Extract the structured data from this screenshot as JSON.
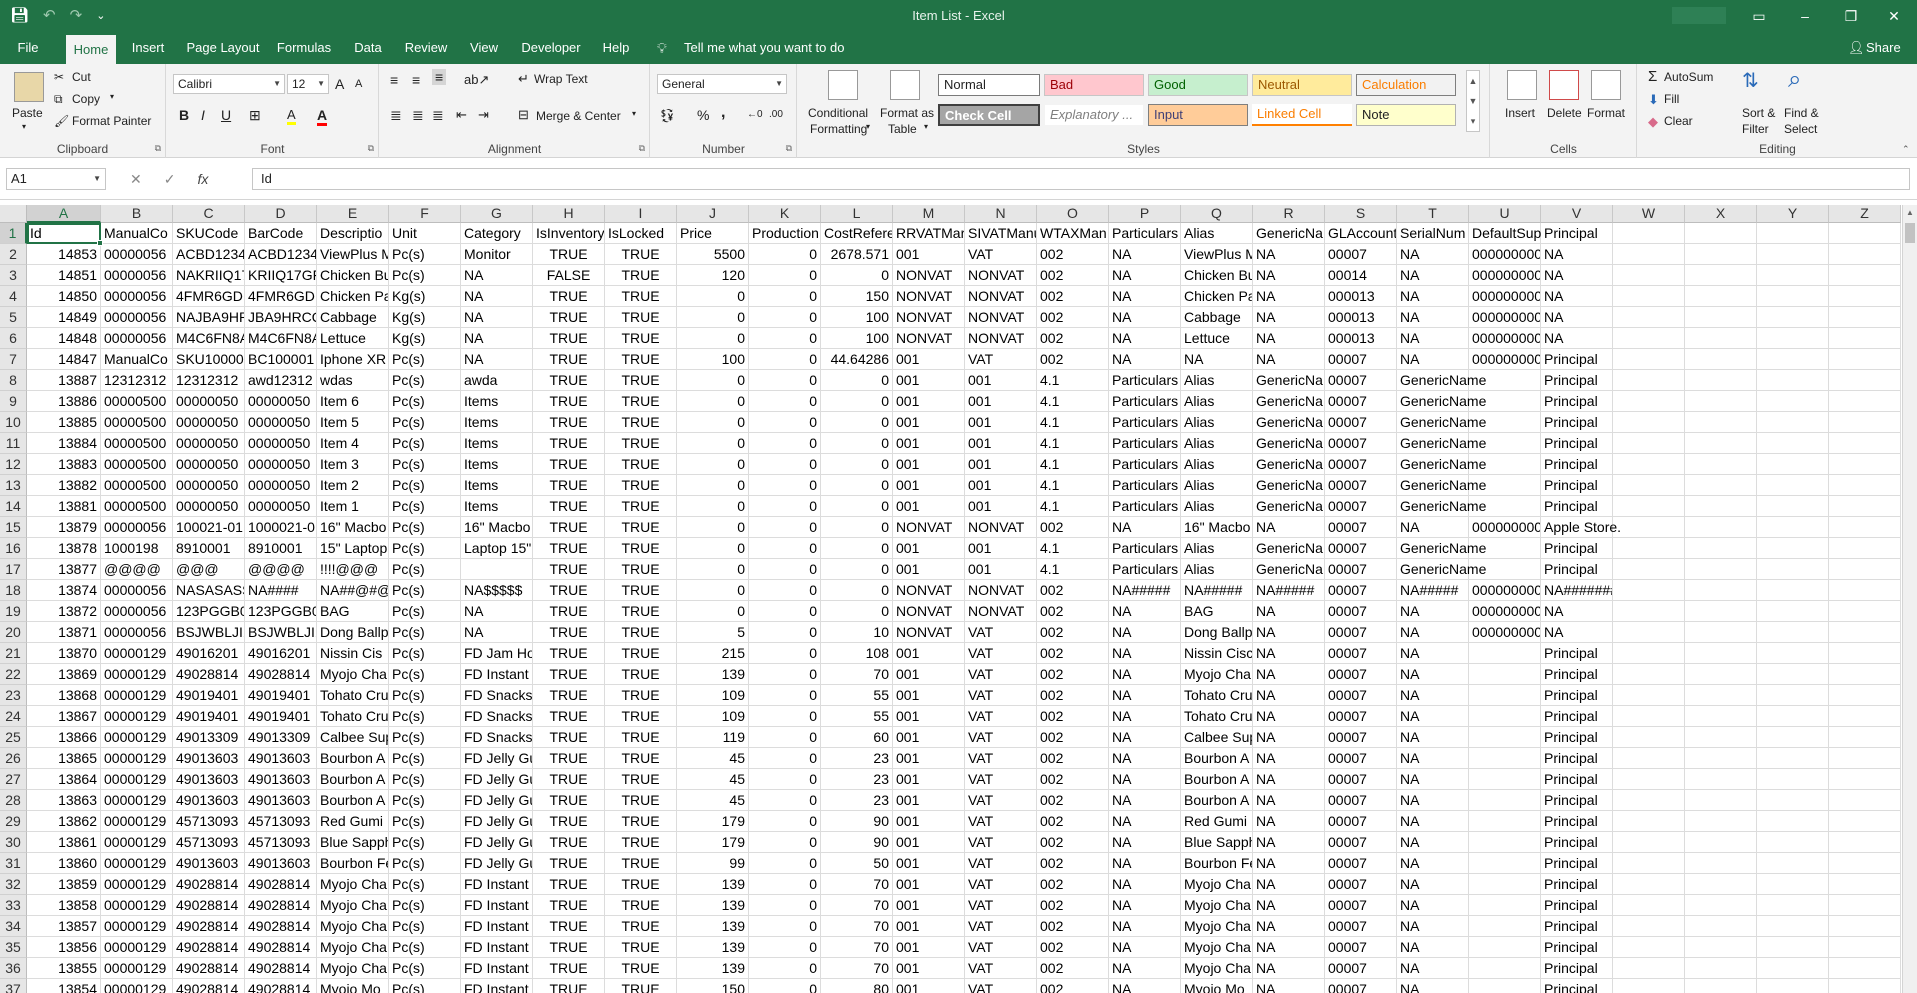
{
  "titlebar": {
    "title": "Item List  -  Excel",
    "save_icon": "save-icon",
    "undo_icon": "undo-icon",
    "redo_icon": "redo-icon",
    "customize_icon": "customize-qat-icon",
    "ribbon_display_icon": "ribbon-display-icon",
    "minimize": "–",
    "restore": "❐",
    "close": "✕"
  },
  "tabs": [
    "File",
    "Home",
    "Insert",
    "Page Layout",
    "Formulas",
    "Data",
    "Review",
    "View",
    "Developer",
    "Help"
  ],
  "active_tab": "Home",
  "tell_me": "Tell me what you want to do",
  "share": "Share",
  "ribbon": {
    "clipboard": {
      "name": "Clipboard",
      "paste": "Paste",
      "cut": "Cut",
      "copy": "Copy",
      "format_painter": "Format Painter"
    },
    "font": {
      "name": "Font",
      "family": "Calibri",
      "size": "12",
      "bold": "B",
      "italic": "I",
      "underline": "U",
      "grow": "A",
      "shrink": "A",
      "fill": "A",
      "color": "A"
    },
    "alignment": {
      "name": "Alignment",
      "wrap": "Wrap Text",
      "merge": "Merge & Center"
    },
    "number": {
      "name": "Number",
      "format": "General",
      "percent": "%",
      "comma": ","
    },
    "styles": {
      "name": "Styles",
      "conditional": "Conditional",
      "conditional2": "Formatting",
      "format_table": "Format as",
      "format_table2": "Table",
      "normal": "Normal",
      "bad": "Bad",
      "good": "Good",
      "neutral": "Neutral",
      "calculation": "Calculation",
      "check_cell": "Check Cell",
      "explanatory": "Explanatory ...",
      "input": "Input",
      "linked_cell": "Linked Cell",
      "note": "Note"
    },
    "cells": {
      "name": "Cells",
      "insert": "Insert",
      "delete": "Delete",
      "format": "Format"
    },
    "editing": {
      "name": "Editing",
      "autosum": "AutoSum",
      "fill": "Fill",
      "clear": "Clear",
      "sort": "Sort &",
      "sort2": "Filter",
      "find": "Find &",
      "find2": "Select"
    }
  },
  "formula_bar": {
    "name_box": "A1",
    "cancel": "✕",
    "enter": "✓",
    "fx": "fx",
    "content": "Id"
  },
  "columns": [
    "A",
    "B",
    "C",
    "D",
    "E",
    "F",
    "G",
    "H",
    "I",
    "J",
    "K",
    "L",
    "M",
    "N",
    "O",
    "P",
    "Q",
    "R",
    "S",
    "T",
    "U",
    "V",
    "W",
    "X",
    "Y",
    "Z"
  ],
  "row_numbers": [
    "1",
    "2",
    "3",
    "4",
    "5",
    "6",
    "7",
    "8",
    "9",
    "10",
    "11",
    "12",
    "13",
    "14",
    "15",
    "16",
    "17",
    "18",
    "19",
    "20",
    "21",
    "22",
    "23",
    "24",
    "25",
    "26",
    "27",
    "28",
    "29",
    "30",
    "31",
    "32",
    "33",
    "34",
    "35",
    "36",
    "37"
  ],
  "rows": [
    [
      "Id",
      "ManualCo",
      "SKUCode",
      "BarCode",
      "Descriptio",
      "Unit",
      "Category",
      "IsInventory",
      "IsLocked",
      "Price",
      "Production",
      "CostRefere",
      "RRVATMar",
      "SIVATManu",
      "WTAXMan",
      "Particulars",
      "Alias",
      "GenericNa",
      "GLAccount",
      "SerialNum",
      "DefaultSup",
      "Principal"
    ],
    [
      "14853",
      "00000056",
      "ACBD1234",
      "ACBD1234",
      "ViewPlus M",
      "Pc(s)",
      "Monitor",
      "TRUE",
      "TRUE",
      "5500",
      "0",
      "2678.571",
      "001",
      "VAT",
      "002",
      "NA",
      "ViewPlus M",
      "NA",
      "00007",
      "NA",
      "000000000",
      "NA"
    ],
    [
      "14851",
      "00000056",
      "NAKRIIQ17",
      "KRIIQ17GF",
      "Chicken Bu",
      "Pc(s)",
      "NA",
      "FALSE",
      "TRUE",
      "120",
      "0",
      "0",
      "NONVAT",
      "NONVAT",
      "002",
      "NA",
      "Chicken Bu",
      "NA",
      "00014",
      "NA",
      "000000000",
      "NA"
    ],
    [
      "14850",
      "00000056",
      "4FMR6GDI",
      "4FMR6GDI",
      "Chicken Pa",
      "Kg(s)",
      "NA",
      "TRUE",
      "TRUE",
      "0",
      "0",
      "150",
      "NONVAT",
      "NONVAT",
      "002",
      "NA",
      "Chicken Pa",
      "NA",
      "000013",
      "NA",
      "000000000",
      "NA"
    ],
    [
      "14849",
      "00000056",
      "NAJBA9HR",
      "JBA9HRCQ",
      "Cabbage",
      "Kg(s)",
      "NA",
      "TRUE",
      "TRUE",
      "0",
      "0",
      "100",
      "NONVAT",
      "NONVAT",
      "002",
      "NA",
      "Cabbage",
      "NA",
      "000013",
      "NA",
      "000000000",
      "NA"
    ],
    [
      "14848",
      "00000056",
      "M4C6FN8A",
      "M4C6FN8A",
      "Lettuce",
      "Kg(s)",
      "NA",
      "TRUE",
      "TRUE",
      "0",
      "0",
      "100",
      "NONVAT",
      "NONVAT",
      "002",
      "NA",
      "Lettuce",
      "NA",
      "000013",
      "NA",
      "000000000",
      "NA"
    ],
    [
      "14847",
      "ManualCo",
      "SKU10000",
      "BC100001",
      "Iphone XR",
      "Pc(s)",
      "NA",
      "TRUE",
      "TRUE",
      "100",
      "0",
      "44.64286",
      "001",
      "VAT",
      "002",
      "NA",
      "NA",
      "NA",
      "00007",
      "NA",
      "000000000",
      "Principal"
    ],
    [
      "13887",
      "12312312",
      "12312312",
      "awd12312",
      "wdas",
      "Pc(s)",
      "awda",
      "TRUE",
      "TRUE",
      "0",
      "0",
      "0",
      "001",
      "001",
      "4.1",
      "Particulars",
      "Alias",
      "GenericNa",
      "00007",
      "GenericName",
      "",
      "Principal"
    ],
    [
      "13886",
      "00000500",
      "00000050",
      "00000050",
      "Item 6",
      "Pc(s)",
      "Items",
      "TRUE",
      "TRUE",
      "0",
      "0",
      "0",
      "001",
      "001",
      "4.1",
      "Particulars",
      "Alias",
      "GenericNa",
      "00007",
      "GenericName",
      "",
      "Principal"
    ],
    [
      "13885",
      "00000500",
      "00000050",
      "00000050",
      "Item 5",
      "Pc(s)",
      "Items",
      "TRUE",
      "TRUE",
      "0",
      "0",
      "0",
      "001",
      "001",
      "4.1",
      "Particulars",
      "Alias",
      "GenericNa",
      "00007",
      "GenericName",
      "",
      "Principal"
    ],
    [
      "13884",
      "00000500",
      "00000050",
      "00000050",
      "Item 4",
      "Pc(s)",
      "Items",
      "TRUE",
      "TRUE",
      "0",
      "0",
      "0",
      "001",
      "001",
      "4.1",
      "Particulars",
      "Alias",
      "GenericNa",
      "00007",
      "GenericName",
      "",
      "Principal"
    ],
    [
      "13883",
      "00000500",
      "00000050",
      "00000050",
      "Item 3",
      "Pc(s)",
      "Items",
      "TRUE",
      "TRUE",
      "0",
      "0",
      "0",
      "001",
      "001",
      "4.1",
      "Particulars",
      "Alias",
      "GenericNa",
      "00007",
      "GenericName",
      "",
      "Principal"
    ],
    [
      "13882",
      "00000500",
      "00000050",
      "00000050",
      "Item 2",
      "Pc(s)",
      "Items",
      "TRUE",
      "TRUE",
      "0",
      "0",
      "0",
      "001",
      "001",
      "4.1",
      "Particulars",
      "Alias",
      "GenericNa",
      "00007",
      "GenericName",
      "",
      "Principal"
    ],
    [
      "13881",
      "00000500",
      "00000050",
      "00000050",
      "Item 1",
      "Pc(s)",
      "Items",
      "TRUE",
      "TRUE",
      "0",
      "0",
      "0",
      "001",
      "001",
      "4.1",
      "Particulars",
      "Alias",
      "GenericNa",
      "00007",
      "GenericName",
      "",
      "Principal"
    ],
    [
      "13879",
      "00000056",
      "100021-01",
      "1000021-0",
      "16\" Macbo",
      "Pc(s)",
      "16\" Macbo",
      "TRUE",
      "TRUE",
      "0",
      "0",
      "0",
      "NONVAT",
      "NONVAT",
      "002",
      "NA",
      "16\" Macbo",
      "NA",
      "00007",
      "NA",
      "000000000",
      "Apple Store."
    ],
    [
      "13878",
      "1000198",
      "8910001",
      "8910001",
      "15\" Laptop",
      "Pc(s)",
      "Laptop 15\"",
      "TRUE",
      "TRUE",
      "0",
      "0",
      "0",
      "001",
      "001",
      "4.1",
      "Particulars",
      "Alias",
      "GenericNa",
      "00007",
      "GenericName",
      "",
      "Principal"
    ],
    [
      "13877",
      "@@@@",
      "@@@",
      "@@@@",
      "!!!!@@@",
      "Pc(s)",
      "",
      "TRUE",
      "TRUE",
      "0",
      "0",
      "0",
      "001",
      "001",
      "4.1",
      "Particulars",
      "Alias",
      "GenericNa",
      "00007",
      "GenericName",
      "",
      "Principal"
    ],
    [
      "13874",
      "00000056",
      "NASASASS",
      "NA####",
      "NA##@#@",
      "Pc(s)",
      "NA$$$$$",
      "TRUE",
      "TRUE",
      "0",
      "0",
      "0",
      "NONVAT",
      "NONVAT",
      "002",
      "NA#####",
      "NA#####",
      "NA#####",
      "00007",
      "NA#####",
      "000000000",
      "NA#######"
    ],
    [
      "13872",
      "00000056",
      "123PGGB0",
      "123PGGB0",
      "BAG",
      "Pc(s)",
      "NA",
      "TRUE",
      "TRUE",
      "0",
      "0",
      "0",
      "NONVAT",
      "NONVAT",
      "002",
      "NA",
      "BAG",
      "NA",
      "00007",
      "NA",
      "000000000",
      "NA"
    ],
    [
      "13871",
      "00000056",
      "BSJWBLJI1",
      "BSJWBLJI1",
      "Dong Ballp",
      "Pc(s)",
      "NA",
      "TRUE",
      "TRUE",
      "5",
      "0",
      "10",
      "NONVAT",
      "VAT",
      "002",
      "NA",
      "Dong Ballp",
      "NA",
      "00007",
      "NA",
      "000000000",
      "NA"
    ],
    [
      "13870",
      "00000129",
      "49016201",
      "49016201",
      "Nissin Cis",
      "Pc(s)",
      "FD Jam Ho",
      "TRUE",
      "TRUE",
      "215",
      "0",
      "108",
      "001",
      "VAT",
      "002",
      "NA",
      "Nissin Cisc",
      "NA",
      "00007",
      "NA",
      "",
      "Principal"
    ],
    [
      "13869",
      "00000129",
      "49028814",
      "49028814",
      "Myojo Cha",
      "Pc(s)",
      "FD Instant",
      "TRUE",
      "TRUE",
      "139",
      "0",
      "70",
      "001",
      "VAT",
      "002",
      "NA",
      "Myojo Cha",
      "NA",
      "00007",
      "NA",
      "",
      "Principal"
    ],
    [
      "13868",
      "00000129",
      "49019401",
      "49019401",
      "Tohato Cru",
      "Pc(s)",
      "FD Snacks",
      "TRUE",
      "TRUE",
      "109",
      "0",
      "55",
      "001",
      "VAT",
      "002",
      "NA",
      "Tohato Cru",
      "NA",
      "00007",
      "NA",
      "",
      "Principal"
    ],
    [
      "13867",
      "00000129",
      "49019401",
      "49019401",
      "Tohato Cru",
      "Pc(s)",
      "FD Snacks",
      "TRUE",
      "TRUE",
      "109",
      "0",
      "55",
      "001",
      "VAT",
      "002",
      "NA",
      "Tohato Cru",
      "NA",
      "00007",
      "NA",
      "",
      "Principal"
    ],
    [
      "13866",
      "00000129",
      "49013309",
      "49013309",
      "Calbee Sup",
      "Pc(s)",
      "FD Snacks",
      "TRUE",
      "TRUE",
      "119",
      "0",
      "60",
      "001",
      "VAT",
      "002",
      "NA",
      "Calbee Sup",
      "NA",
      "00007",
      "NA",
      "",
      "Principal"
    ],
    [
      "13865",
      "00000129",
      "49013603",
      "49013603",
      "Bourbon A",
      "Pc(s)",
      "FD Jelly Gu",
      "TRUE",
      "TRUE",
      "45",
      "0",
      "23",
      "001",
      "VAT",
      "002",
      "NA",
      "Bourbon A",
      "NA",
      "00007",
      "NA",
      "",
      "Principal"
    ],
    [
      "13864",
      "00000129",
      "49013603",
      "49013603",
      "Bourbon A",
      "Pc(s)",
      "FD Jelly Gu",
      "TRUE",
      "TRUE",
      "45",
      "0",
      "23",
      "001",
      "VAT",
      "002",
      "NA",
      "Bourbon A",
      "NA",
      "00007",
      "NA",
      "",
      "Principal"
    ],
    [
      "13863",
      "00000129",
      "49013603",
      "49013603",
      "Bourbon A",
      "Pc(s)",
      "FD Jelly Gu",
      "TRUE",
      "TRUE",
      "45",
      "0",
      "23",
      "001",
      "VAT",
      "002",
      "NA",
      "Bourbon A",
      "NA",
      "00007",
      "NA",
      "",
      "Principal"
    ],
    [
      "13862",
      "00000129",
      "45713093",
      "45713093",
      "Red Gumi",
      "Pc(s)",
      "FD Jelly Gu",
      "TRUE",
      "TRUE",
      "179",
      "0",
      "90",
      "001",
      "VAT",
      "002",
      "NA",
      "Red Gumi",
      "NA",
      "00007",
      "NA",
      "",
      "Principal"
    ],
    [
      "13861",
      "00000129",
      "45713093",
      "45713093",
      "Blue Sapph",
      "Pc(s)",
      "FD Jelly Gu",
      "TRUE",
      "TRUE",
      "179",
      "0",
      "90",
      "001",
      "VAT",
      "002",
      "NA",
      "Blue Sapph",
      "NA",
      "00007",
      "NA",
      "",
      "Principal"
    ],
    [
      "13860",
      "00000129",
      "49013603",
      "49013603",
      "Bourbon Fe",
      "Pc(s)",
      "FD Jelly Gu",
      "TRUE",
      "TRUE",
      "99",
      "0",
      "50",
      "001",
      "VAT",
      "002",
      "NA",
      "Bourbon Fe",
      "NA",
      "00007",
      "NA",
      "",
      "Principal"
    ],
    [
      "13859",
      "00000129",
      "49028814",
      "49028814",
      "Myojo Cha",
      "Pc(s)",
      "FD Instant",
      "TRUE",
      "TRUE",
      "139",
      "0",
      "70",
      "001",
      "VAT",
      "002",
      "NA",
      "Myojo Cha",
      "NA",
      "00007",
      "NA",
      "",
      "Principal"
    ],
    [
      "13858",
      "00000129",
      "49028814",
      "49028814",
      "Myojo Cha",
      "Pc(s)",
      "FD Instant",
      "TRUE",
      "TRUE",
      "139",
      "0",
      "70",
      "001",
      "VAT",
      "002",
      "NA",
      "Myojo Cha",
      "NA",
      "00007",
      "NA",
      "",
      "Principal"
    ],
    [
      "13857",
      "00000129",
      "49028814",
      "49028814",
      "Myojo Cha",
      "Pc(s)",
      "FD Instant",
      "TRUE",
      "TRUE",
      "139",
      "0",
      "70",
      "001",
      "VAT",
      "002",
      "NA",
      "Myojo Cha",
      "NA",
      "00007",
      "NA",
      "",
      "Principal"
    ],
    [
      "13856",
      "00000129",
      "49028814",
      "49028814",
      "Myojo Cha",
      "Pc(s)",
      "FD Instant",
      "TRUE",
      "TRUE",
      "139",
      "0",
      "70",
      "001",
      "VAT",
      "002",
      "NA",
      "Myojo Cha",
      "NA",
      "00007",
      "NA",
      "",
      "Principal"
    ],
    [
      "13855",
      "00000129",
      "49028814",
      "49028814",
      "Myojo Cha",
      "Pc(s)",
      "FD Instant",
      "TRUE",
      "TRUE",
      "139",
      "0",
      "70",
      "001",
      "VAT",
      "002",
      "NA",
      "Myojo Cha",
      "NA",
      "00007",
      "NA",
      "",
      "Principal"
    ],
    [
      "13854",
      "00000129",
      "49028814",
      "49028814",
      "Myojo Mo",
      "Pc(s)",
      "FD Instant",
      "TRUE",
      "TRUE",
      "150",
      "0",
      "80",
      "001",
      "VAT",
      "002",
      "NA",
      "Myojo Mo",
      "NA",
      "00007",
      "NA",
      "",
      "Principal"
    ]
  ],
  "colors": {
    "accent": "#217346",
    "bad_bg": "#ffc7ce",
    "bad_fg": "#9c0006",
    "good_bg": "#c6efce",
    "good_fg": "#006100",
    "neutral_bg": "#ffeb9c",
    "neutral_fg": "#9c5700",
    "calc_bg": "#f2f2f2",
    "calc_fg": "#fa7d00",
    "check_bg": "#a5a5a5",
    "input_bg": "#ffcc99",
    "input_fg": "#3f3f76",
    "linked_fg": "#fa7d00",
    "note_bg": "#ffffcc"
  }
}
